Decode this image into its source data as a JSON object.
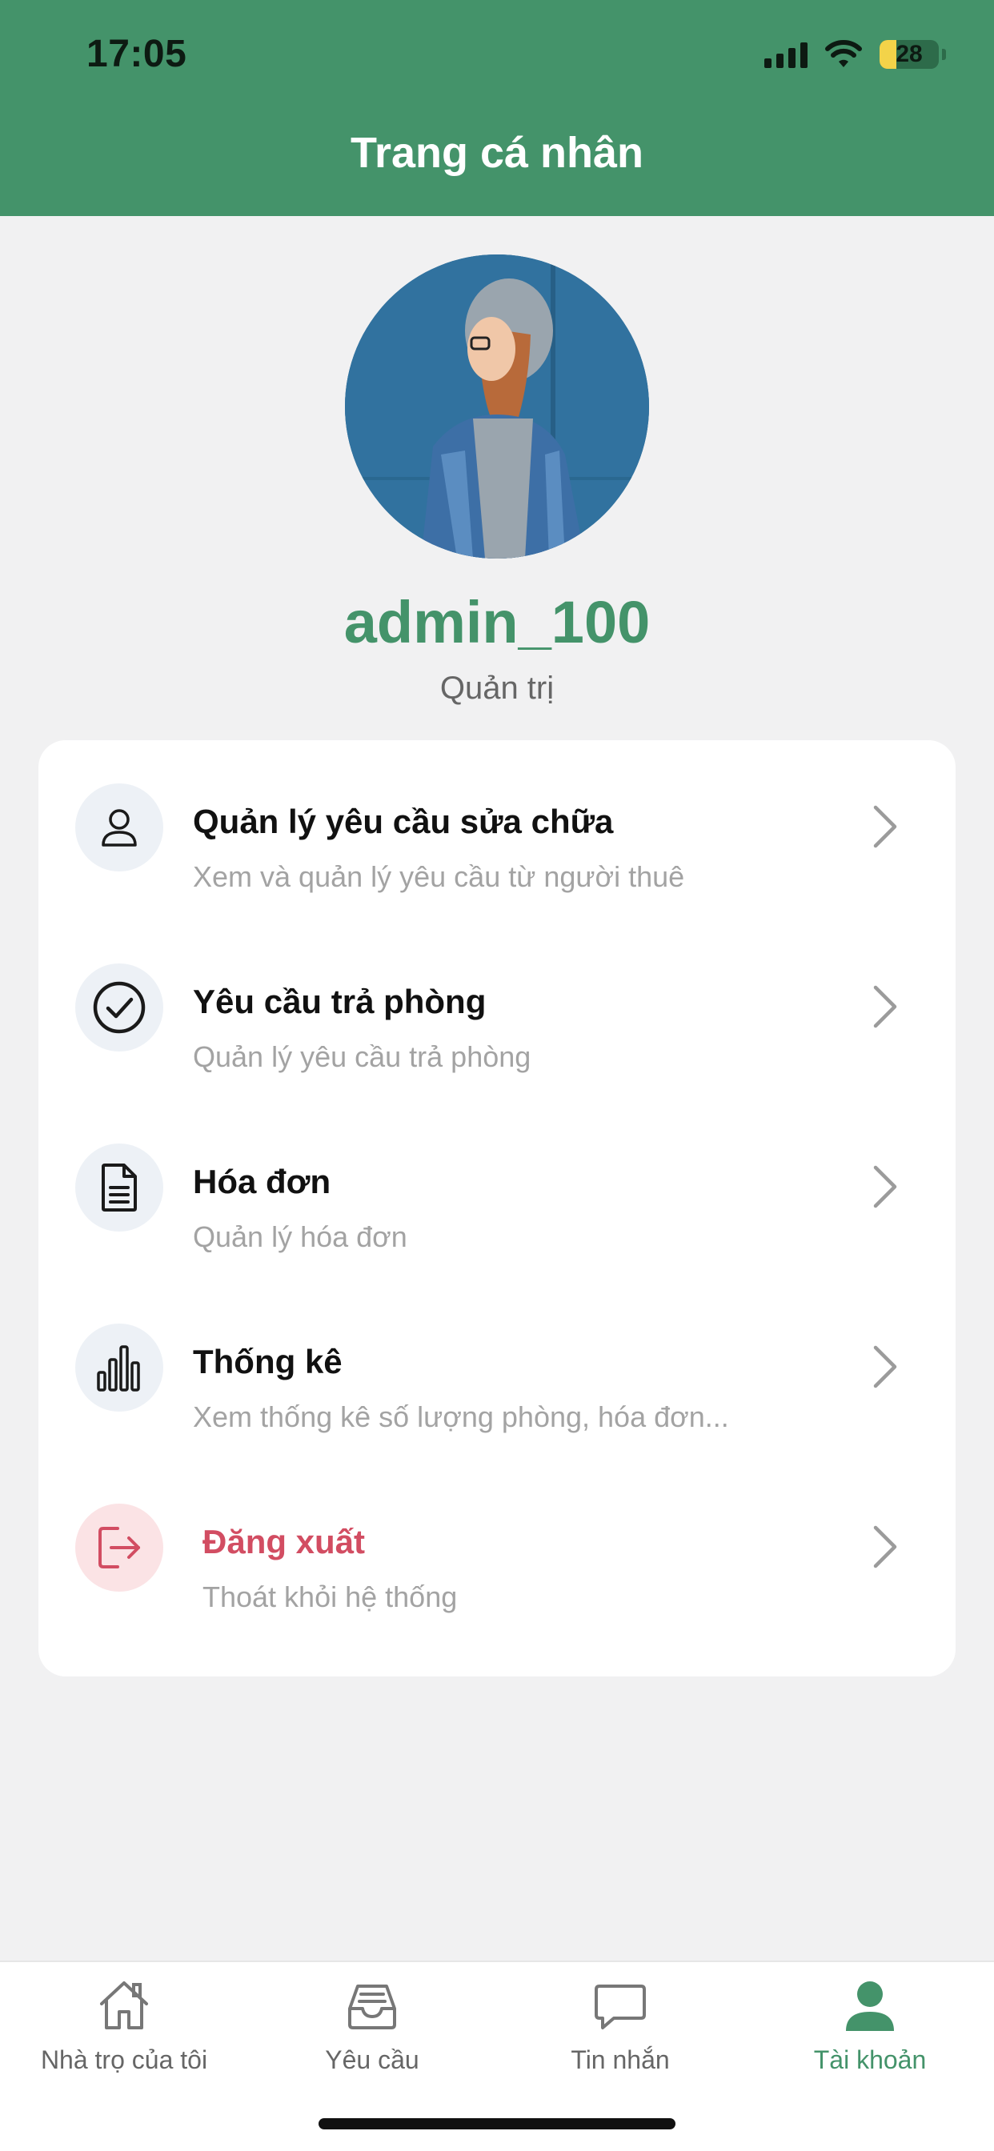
{
  "status": {
    "time": "17:05",
    "battery": "28"
  },
  "header": {
    "title": "Trang cá nhân"
  },
  "profile": {
    "username": "admin_100",
    "role": "Quản trị"
  },
  "menu": [
    {
      "title": "Quản lý yêu cầu sửa chữa",
      "subtitle": "Xem và quản lý yêu cầu từ người thuê",
      "icon": "user-icon"
    },
    {
      "title": "Yêu cầu trả phòng",
      "subtitle": "Quản lý yêu cầu trả phòng",
      "icon": "check-circle-icon"
    },
    {
      "title": "Hóa đơn",
      "subtitle": "Quản lý hóa đơn",
      "icon": "document-icon"
    },
    {
      "title": "Thống kê",
      "subtitle": "Xem thống kê số lượng phòng, hóa đơn...",
      "icon": "bar-chart-icon"
    },
    {
      "title": "Đăng xuất",
      "subtitle": "Thoát khỏi hệ thống",
      "icon": "logout-icon"
    }
  ],
  "tabs": [
    {
      "label": "Nhà trọ của tôi",
      "icon": "home-icon"
    },
    {
      "label": "Yêu cầu",
      "icon": "inbox-icon"
    },
    {
      "label": "Tin nhắn",
      "icon": "chat-icon"
    },
    {
      "label": "Tài khoản",
      "icon": "account-icon",
      "active": true
    }
  ],
  "colors": {
    "brand": "#44936a",
    "danger": "#d24d62",
    "background": "#f1f1f2"
  }
}
